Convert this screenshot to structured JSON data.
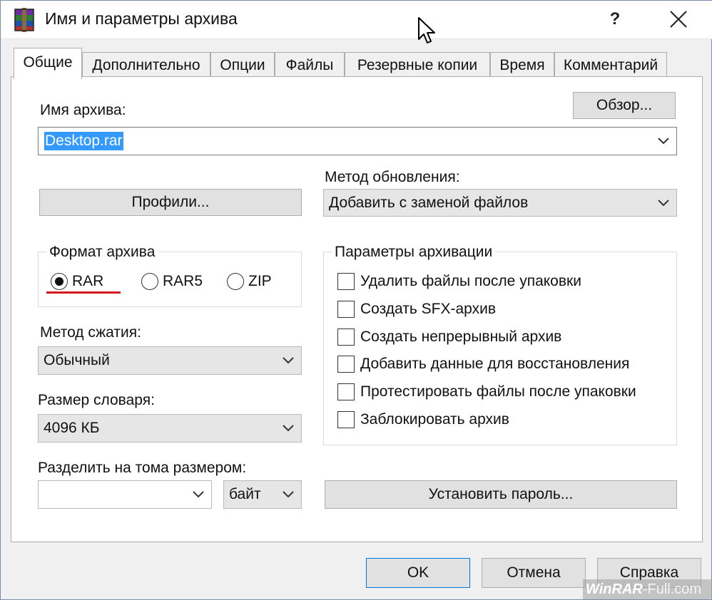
{
  "window": {
    "title": "Имя и параметры архива",
    "help_label": "?"
  },
  "tabs": [
    {
      "label": "Общие",
      "active": true
    },
    {
      "label": "Дополнительно",
      "active": false
    },
    {
      "label": "Опции",
      "active": false
    },
    {
      "label": "Файлы",
      "active": false
    },
    {
      "label": "Резервные копии",
      "active": false
    },
    {
      "label": "Время",
      "active": false
    },
    {
      "label": "Комментарий",
      "active": false
    }
  ],
  "archive_name": {
    "label": "Имя архива:",
    "value": "Desktop.rar",
    "browse_label": "Обзор..."
  },
  "profiles_label": "Профили...",
  "update_method": {
    "label": "Метод обновления:",
    "value": "Добавить с заменой файлов"
  },
  "format": {
    "group_label": "Формат архива",
    "options": [
      {
        "label": "RAR",
        "selected": true
      },
      {
        "label": "RAR5",
        "selected": false
      },
      {
        "label": "ZIP",
        "selected": false
      }
    ]
  },
  "archive_params": {
    "group_label": "Параметры архивации",
    "options": [
      {
        "label": "Удалить файлы после упаковки",
        "checked": false
      },
      {
        "label": "Создать SFX-архив",
        "checked": false
      },
      {
        "label": "Создать непрерывный архив",
        "checked": false
      },
      {
        "label": "Добавить данные для восстановления",
        "checked": false
      },
      {
        "label": "Протестировать файлы после упаковки",
        "checked": false
      },
      {
        "label": "Заблокировать архив",
        "checked": false
      }
    ]
  },
  "compression": {
    "label": "Метод сжатия:",
    "value": "Обычный"
  },
  "dictionary": {
    "label": "Размер словаря:",
    "value": "4096 КБ"
  },
  "split": {
    "label": "Разделить на тома размером:",
    "value": "",
    "unit": "байт"
  },
  "set_password_label": "Установить пароль...",
  "footer": {
    "ok": "OK",
    "cancel": "Отмена",
    "help": "Справка"
  },
  "watermark": {
    "brand": "WinRAR",
    "suffix": "-Full.com"
  },
  "colors": {
    "selection": "#3399ff",
    "annotation_red": "#d4161e"
  }
}
